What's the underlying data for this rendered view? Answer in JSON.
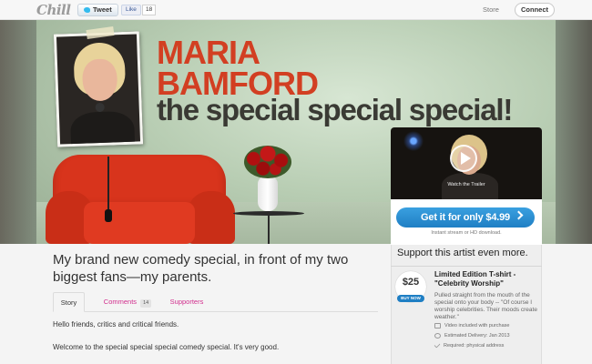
{
  "topbar": {
    "logo": "Chill",
    "tweet_label": "Tweet",
    "like_label": "Like",
    "like_count": "18",
    "store_label": "Store",
    "connect_label": "Connect"
  },
  "hero": {
    "title_line1": "MARIA",
    "title_line2": "BAMFORD",
    "subtitle": "the special special special!",
    "trailer_caption": "Watch the Trailer"
  },
  "purchase": {
    "button_label": "Get it for only $4.99",
    "note": "Instant stream or HD download."
  },
  "support": {
    "heading": "Support this artist even more.",
    "reward": {
      "price": "$25",
      "buy_label": "BUY NOW",
      "title": "Limited Edition T-shirt - \"Celebrity Worship\"",
      "description": "Pulled straight from the mouth of the special onto your body -- \"Of course I worship celebrities. Their moods create weather.\"",
      "meta": [
        "Video included with purchase",
        "Estimated Delivery: Jan 2013",
        "Required: physical address"
      ]
    }
  },
  "main": {
    "title": "My brand new comedy special, in front of my two biggest fans—my parents.",
    "tabs": {
      "story": "Story",
      "comments": "Comments",
      "comments_count": "14",
      "supporters": "Supporters"
    },
    "story": {
      "paragraph1": "Hello friends, critics and critical friends.",
      "paragraph2": "Welcome to the special special special comedy special.  It's very good."
    }
  },
  "colors": {
    "accent_pink": "#d12c8c",
    "brand_blue": "#1f7fc4",
    "title_red": "#d23f22"
  }
}
